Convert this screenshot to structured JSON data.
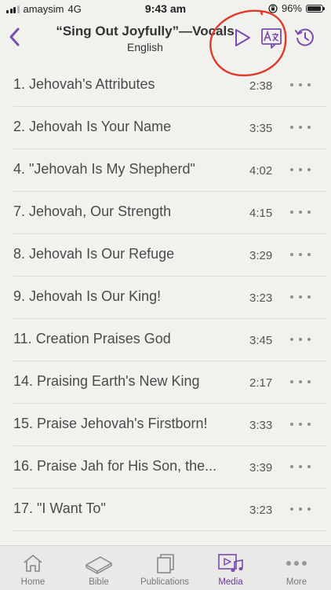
{
  "status_bar": {
    "carrier": "amaysim",
    "network": "4G",
    "time": "9:43 am",
    "battery": "96%",
    "battery_level": 0.96
  },
  "header": {
    "title": "“Sing Out Joyfully”—Vocals",
    "subtitle": "English",
    "back_icon": "chevron-left-icon",
    "play_icon": "play-icon",
    "language_icon": "language-icon",
    "history_icon": "history-icon"
  },
  "songs": [
    {
      "title": "1. Jehovah's Attributes",
      "duration": "2:38"
    },
    {
      "title": "2. Jehovah Is Your Name",
      "duration": "3:35"
    },
    {
      "title": "4. \"Jehovah Is My Shepherd\"",
      "duration": "4:02"
    },
    {
      "title": "7. Jehovah, Our Strength",
      "duration": "4:15"
    },
    {
      "title": "8. Jehovah Is Our Refuge",
      "duration": "3:29"
    },
    {
      "title": "9. Jehovah Is Our King!",
      "duration": "3:23"
    },
    {
      "title": "11. Creation Praises God",
      "duration": "3:45"
    },
    {
      "title": "14. Praising Earth's New King",
      "duration": "2:17"
    },
    {
      "title": "15. Praise Jehovah's Firstborn!",
      "duration": "3:33"
    },
    {
      "title": "16. Praise Jah for His Son, the...",
      "duration": "3:39"
    },
    {
      "title": "17. \"I Want To\"",
      "duration": "3:23"
    }
  ],
  "tabbar": {
    "tabs": [
      {
        "label": "Home",
        "icon": "home-icon"
      },
      {
        "label": "Bible",
        "icon": "bible-icon"
      },
      {
        "label": "Publications",
        "icon": "publications-icon"
      },
      {
        "label": "Media",
        "icon": "media-icon",
        "active": true
      },
      {
        "label": "More",
        "icon": "more-icon"
      }
    ]
  },
  "colors": {
    "accent": "#7a4ab0",
    "annotation": "#e03a2a",
    "background": "#f1f1ee"
  }
}
